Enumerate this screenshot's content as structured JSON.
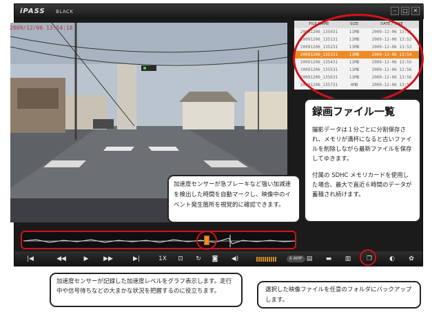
{
  "app": {
    "logo": "iPASS",
    "logo_sub": "BLACK"
  },
  "window_buttons": [
    "–",
    "□",
    "✕"
  ],
  "video": {
    "timestamp": "2009/12/06 13:54:18"
  },
  "file_list": {
    "headers": {
      "name": "FILE NAME",
      "size": "SIZE",
      "date": "DATE / TIME"
    },
    "rows": [
      {
        "name": "20091206_135031",
        "size": "11MB",
        "date": "2009-12-06 13:51"
      },
      {
        "name": "20091206_135131",
        "size": "11MB",
        "date": "2009-12-06 13:52"
      },
      {
        "name": "20091206_135231",
        "size": "11MB",
        "date": "2009-12-06 13:53"
      },
      {
        "name": "20091206_135331",
        "size": "11MB",
        "date": "2009-12-06 13:54"
      },
      {
        "name": "20091206_135431",
        "size": "11MB",
        "date": "2009-12-06 13:55"
      },
      {
        "name": "20091206_135531",
        "size": "11MB",
        "date": "2009-12-06 13:56"
      },
      {
        "name": "20091206_135631",
        "size": "11MB",
        "date": "2009-12-06 13:56"
      },
      {
        "name": "20091206_135731",
        "size": "4MB",
        "date": "2009-12-06 13:57"
      }
    ],
    "selected_index": 3
  },
  "callouts": {
    "file_list_title": "録画ファイル一覧",
    "file_list_p1": "撮影データは１分ごとに分割保存され、メモリが満杯になると古いファイルを削除しながら最新ファイルを保存してゆきます。",
    "file_list_p2": "付属の SDHC メモリカードを使用した場合、最大で直近６時間のデータが蓄積され続けます。",
    "accel": "加速度センサーが急ブレーキなど強い加減速を検出した時間を自動マークし、映像中のイベント発生箇所を視覚的に確認できます。",
    "graph": "加速度センサーが記録した加速度レベルをグラフ表示します。走行中や信号待ちなどの大まかな状況を把握するのに役立ちます。",
    "backup": "選択した映像ファイルを任意のフォルダにバックアップします。"
  },
  "controls": {
    "prev_label": "|◀",
    "rewind_label": "◀◀",
    "play_label": "▶",
    "ffwd_label": "▶▶",
    "next_label": "▶|",
    "speed_label": "1X",
    "fit_label": "⊡",
    "rotate_label": "↻",
    "snapshot_label": "◙",
    "volume_label": "◀)",
    "amp_label": "6 AMP",
    "open_label": "▤",
    "folder_label": "▬",
    "delete_label": "▥",
    "backup_label": "❐",
    "info_label": "◐",
    "settings_label": "✿"
  },
  "colors": {
    "accent": "#f08a24",
    "highlight": "#d31218"
  }
}
